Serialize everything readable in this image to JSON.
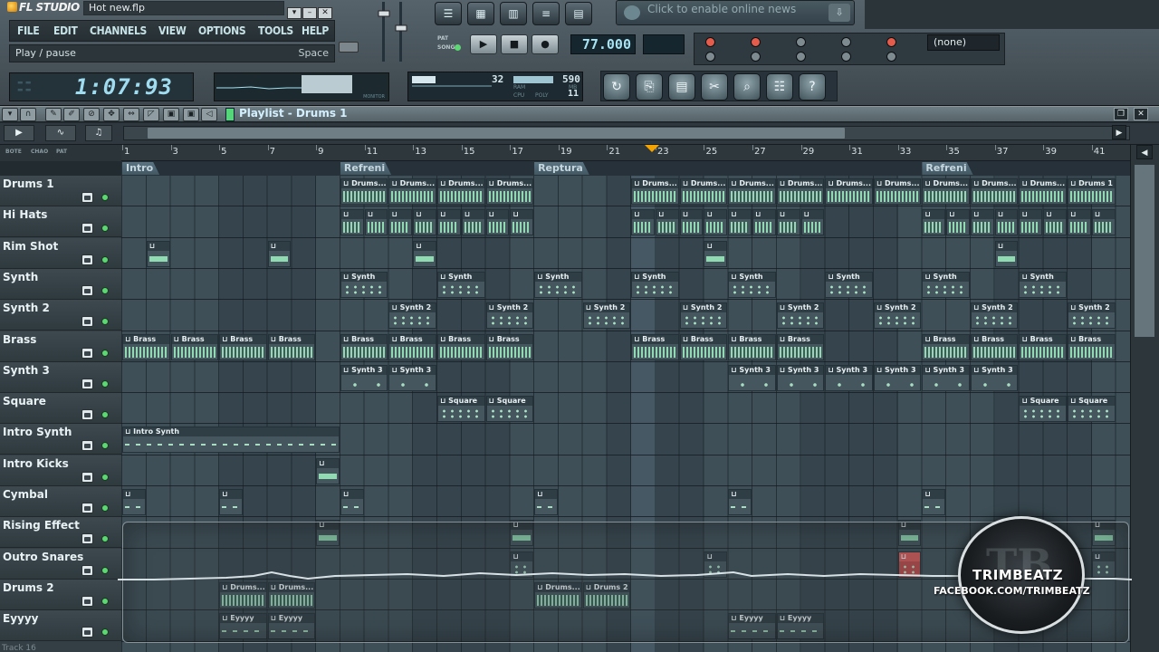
{
  "app": {
    "logo": "FL STUDIO",
    "project_title": "Hot new.flp"
  },
  "menu": [
    "FILE",
    "EDIT",
    "CHANNELS",
    "VIEW",
    "OPTIONS",
    "TOOLS",
    "HELP"
  ],
  "hint": {
    "text": "Play / pause",
    "key": "Space"
  },
  "clock": {
    "time": "1:07:93"
  },
  "waveform": {
    "label": "MONITOR"
  },
  "cpu": {
    "value1": "32",
    "value2": "590",
    "label_ram": "RAM",
    "label_cpu": "CPU",
    "label_poly": "POLY",
    "label_mb": "MB",
    "poly": "11"
  },
  "transport": {
    "tempo": "77.000",
    "mode_pat": "PAT",
    "mode_song": "SONG"
  },
  "news": {
    "text": "Click to enable online news"
  },
  "snap": {
    "value": "(none)"
  },
  "playlist": {
    "title": "Playlist - Drums 1",
    "sub_labels": [
      "BOTE",
      "CHAO",
      "PAT"
    ]
  },
  "ruler": [
    "1",
    "3",
    "5",
    "7",
    "9",
    "11",
    "13",
    "15",
    "17",
    "19",
    "21",
    "23",
    "25",
    "27",
    "29",
    "31",
    "33",
    "35",
    "37",
    "39",
    "41"
  ],
  "markers": [
    {
      "label": "Intro",
      "bar": 1
    },
    {
      "label": "Refreni",
      "bar": 10
    },
    {
      "label": "Reptura",
      "bar": 18
    },
    {
      "label": "Refreni",
      "bar": 34
    }
  ],
  "tracks": [
    "Drums 1",
    "Hi Hats",
    "Rim Shot",
    "Synth",
    "Synth 2",
    "Brass",
    "Synth 3",
    "Square",
    "Intro Synth",
    "Intro Kicks",
    "Cymbal",
    "Rising Effect",
    "Outro Snares",
    "Drums 2",
    "Eyyyy"
  ],
  "clips": [
    {
      "track": 0,
      "bars": [
        [
          10,
          12
        ],
        [
          12,
          14
        ],
        [
          14,
          16
        ],
        [
          16,
          18
        ],
        [
          22,
          24
        ],
        [
          24,
          26
        ],
        [
          26,
          28
        ],
        [
          28,
          30
        ],
        [
          30,
          32
        ],
        [
          32,
          34
        ],
        [
          34,
          36
        ],
        [
          36,
          38
        ],
        [
          38,
          40
        ],
        [
          40,
          42
        ]
      ],
      "labels": [
        "Drums...",
        "Drums...",
        "Drums...",
        "Drums...",
        "Drums...",
        "Drums...",
        "Drums...",
        "Drums...",
        "Drums...",
        "Drums...",
        "Drums...",
        "Drums...",
        "Drums...",
        "Drums 1"
      ],
      "style": "dense"
    },
    {
      "track": 1,
      "bars": [
        [
          10,
          11
        ],
        [
          11,
          12
        ],
        [
          12,
          13
        ],
        [
          13,
          14
        ],
        [
          14,
          15
        ],
        [
          15,
          16
        ],
        [
          16,
          17
        ],
        [
          17,
          18
        ],
        [
          22,
          23
        ],
        [
          23,
          24
        ],
        [
          24,
          25
        ],
        [
          25,
          26
        ],
        [
          26,
          27
        ],
        [
          27,
          28
        ],
        [
          28,
          29
        ],
        [
          29,
          30
        ],
        [
          34,
          35
        ],
        [
          35,
          36
        ],
        [
          36,
          37
        ],
        [
          37,
          38
        ],
        [
          38,
          39
        ],
        [
          39,
          40
        ],
        [
          40,
          41
        ],
        [
          41,
          42
        ]
      ],
      "style": "dense"
    },
    {
      "track": 2,
      "bars": [
        [
          2,
          3
        ],
        [
          7,
          8
        ],
        [
          13,
          14
        ],
        [
          25,
          26
        ],
        [
          37,
          38
        ]
      ],
      "style": "bar"
    },
    {
      "track": 3,
      "bars": [
        [
          10,
          12
        ],
        [
          14,
          16
        ],
        [
          18,
          20
        ],
        [
          22,
          24
        ],
        [
          26,
          28
        ],
        [
          30,
          32
        ],
        [
          34,
          36
        ],
        [
          38,
          40
        ]
      ],
      "label": "Synth",
      "style": "notes"
    },
    {
      "track": 4,
      "bars": [
        [
          12,
          14
        ],
        [
          16,
          18
        ],
        [
          20,
          22
        ],
        [
          24,
          26
        ],
        [
          28,
          30
        ],
        [
          32,
          34
        ],
        [
          36,
          38
        ],
        [
          40,
          42
        ]
      ],
      "label": "Synth 2",
      "style": "notes"
    },
    {
      "track": 5,
      "bars": [
        [
          1,
          3
        ],
        [
          3,
          5
        ],
        [
          5,
          7
        ],
        [
          7,
          9
        ],
        [
          10,
          12
        ],
        [
          12,
          14
        ],
        [
          14,
          16
        ],
        [
          16,
          18
        ],
        [
          22,
          24
        ],
        [
          24,
          26
        ],
        [
          26,
          28
        ],
        [
          28,
          30
        ],
        [
          34,
          36
        ],
        [
          36,
          38
        ],
        [
          38,
          40
        ],
        [
          40,
          42
        ]
      ],
      "label": "Brass",
      "style": "dense"
    },
    {
      "track": 6,
      "bars": [
        [
          10,
          12
        ],
        [
          12,
          14
        ],
        [
          26,
          28
        ],
        [
          28,
          30
        ],
        [
          30,
          32
        ],
        [
          32,
          34
        ],
        [
          34,
          36
        ],
        [
          36,
          38
        ]
      ],
      "label": "Synth 3",
      "style": "sparse"
    },
    {
      "track": 7,
      "bars": [
        [
          14,
          16
        ],
        [
          16,
          18
        ],
        [
          38,
          40
        ],
        [
          40,
          42
        ]
      ],
      "label": "Square",
      "style": "notes"
    },
    {
      "track": 8,
      "bars": [
        [
          1,
          10
        ]
      ],
      "label": "Intro Synth",
      "style": "dashed"
    },
    {
      "track": 9,
      "bars": [
        [
          9,
          10
        ]
      ],
      "style": "bar"
    },
    {
      "track": 10,
      "bars": [
        [
          1,
          2
        ],
        [
          5,
          6
        ],
        [
          10,
          11
        ],
        [
          18,
          19
        ],
        [
          26,
          27
        ],
        [
          34,
          35
        ]
      ],
      "style": "dashed"
    },
    {
      "track": 11,
      "bars": [
        [
          9,
          10
        ],
        [
          17,
          18
        ],
        [
          33,
          34
        ],
        [
          41,
          42
        ]
      ],
      "style": "bar"
    },
    {
      "track": 12,
      "bars": [
        [
          17,
          18
        ],
        [
          25,
          26
        ],
        [
          33,
          34
        ],
        [
          41,
          42
        ]
      ],
      "style": "notes"
    },
    {
      "track": 13,
      "bars": [
        [
          5,
          7
        ],
        [
          7,
          9
        ],
        [
          18,
          20
        ],
        [
          20,
          22
        ]
      ],
      "labels": [
        "Drums...",
        "Drums...",
        "Drums...",
        "Drums 2"
      ],
      "style": "dense"
    },
    {
      "track": 14,
      "bars": [
        [
          5,
          7
        ],
        [
          7,
          9
        ],
        [
          26,
          28
        ],
        [
          28,
          30
        ]
      ],
      "label": "Eyyyy",
      "style": "dashed"
    }
  ],
  "badge": {
    "letters": "TB",
    "name": "TRIMBEATZ",
    "facebook": "FACEBOOK.COM/TRIMBEATZ"
  },
  "footer_track": "Track 16"
}
